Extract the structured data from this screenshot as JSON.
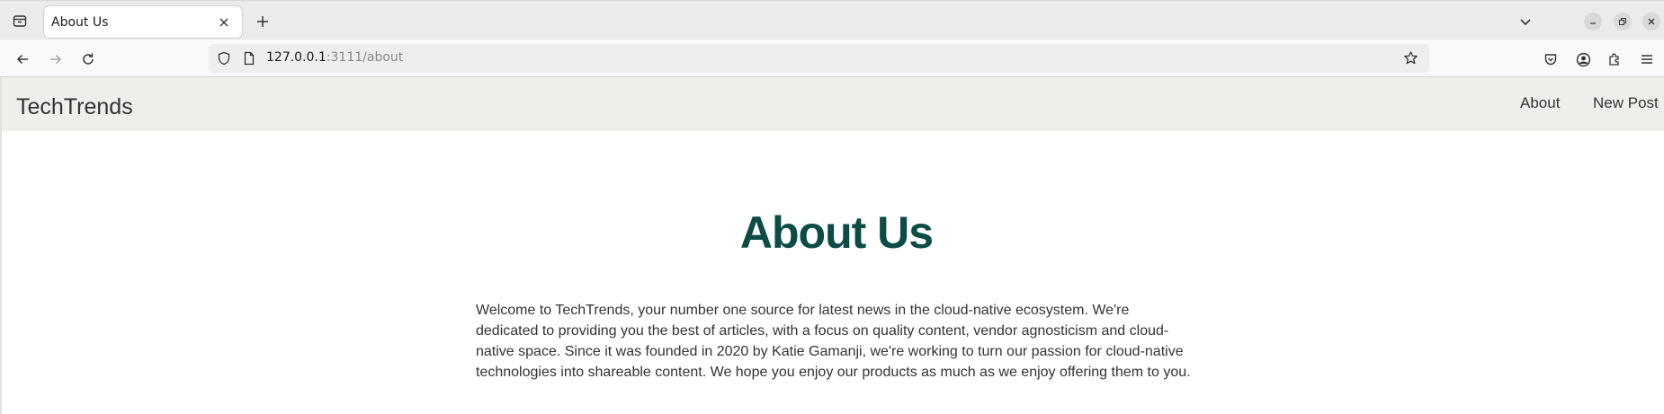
{
  "browser": {
    "tab": {
      "title": "About Us"
    },
    "address": {
      "host": "127.0.0.1",
      "rest": ":3111/about"
    }
  },
  "site": {
    "brand": "TechTrends",
    "nav": [
      {
        "label": "About"
      },
      {
        "label": "New Post"
      }
    ]
  },
  "page": {
    "title": "About Us",
    "intro": "Welcome to TechTrends, your number one source for latest news in the cloud-native ecosystem. We're dedicated to providing you the best of articles, with a focus on quality content, vendor agnosticism and cloud-native space. Since it was founded in 2020 by Katie Gamanji, we're working to turn our passion for cloud-native technologies into shareable content. We hope you enjoy our products as much as we enjoy offering them to you."
  },
  "colors": {
    "title": "#0d4b45",
    "header_bg": "#efeeea",
    "text": "#333333"
  },
  "icons": [
    "tab-list-icon",
    "close-icon",
    "plus-icon",
    "chevron-down-icon",
    "minimize-icon",
    "restore-icon",
    "window-close-icon",
    "back-arrow-icon",
    "forward-arrow-icon",
    "reload-icon",
    "shield-icon",
    "page-icon",
    "star-icon",
    "pocket-icon",
    "account-icon",
    "extensions-icon",
    "menu-icon"
  ]
}
